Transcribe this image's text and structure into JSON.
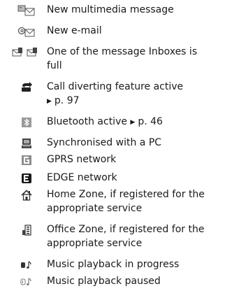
{
  "items": [
    {
      "icon": "multimedia-message-icon",
      "lines": [
        "New multimedia message"
      ]
    },
    {
      "icon": "email-icon",
      "lines": [
        "New e-mail"
      ]
    },
    {
      "icon": "inbox-full-icon",
      "lines": [
        "One of the message Inboxes is",
        "full"
      ]
    },
    {
      "icon": "call-divert-icon",
      "lines": [
        "Call diverting feature active"
      ],
      "ref": "p. 97"
    },
    {
      "icon": "bluetooth-icon",
      "lines": [
        "Bluetooth active"
      ],
      "ref_inline": "p. 46"
    },
    {
      "icon": "pc-sync-icon",
      "lines": [
        "Synchronised with a PC"
      ]
    },
    {
      "icon": "gprs-icon",
      "lines": [
        "GPRS network"
      ]
    },
    {
      "icon": "edge-icon",
      "lines": [
        "EDGE network"
      ]
    },
    {
      "icon": "home-zone-icon",
      "lines": [
        "Home Zone, if registered for the",
        "appropriate service"
      ]
    },
    {
      "icon": "office-zone-icon",
      "lines": [
        "Office Zone, if registered for the",
        "appropriate service"
      ]
    },
    {
      "icon": "music-playing-icon",
      "lines": [
        "Music playback in progress"
      ]
    },
    {
      "icon": "music-paused-icon",
      "lines": [
        "Music playback paused"
      ]
    }
  ],
  "arrow_glyph": "▶"
}
